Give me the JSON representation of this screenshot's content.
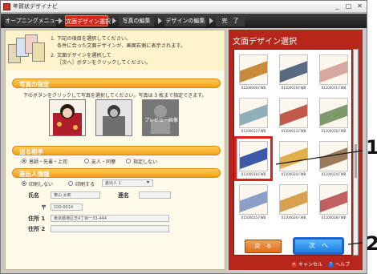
{
  "window": {
    "title": "年賀状デザイナビ"
  },
  "nav": {
    "steps": [
      {
        "label": "オープニングメニュー",
        "active": false
      },
      {
        "label": "文面デザイン選択",
        "active": true
      },
      {
        "label": "写真の編集",
        "active": false
      },
      {
        "label": "デザインの編集",
        "active": false
      },
      {
        "label": "完　了",
        "active": false
      }
    ]
  },
  "instructions": {
    "line1": "1. 下記の項目を選択してください。",
    "line2": "条件に合った文面デザインが、画面右側に表示されます。",
    "line3": "2. 文面デザインを選択して",
    "line4": "［次へ］ボタンをクリックしてください。"
  },
  "photo": {
    "section_title": "写真の指定",
    "hint": "下のボタンをクリックして写真を選択してください。写真は 3 枚まで指定できます。",
    "preview_label": "プレビュー画像"
  },
  "recipient": {
    "section_title": "送る相手",
    "options": [
      {
        "label": "恩師・先輩・上司",
        "checked": true
      },
      {
        "label": "友人・同僚",
        "checked": false
      },
      {
        "label": "指定しない",
        "checked": false
      }
    ]
  },
  "sender": {
    "section_title": "差出人情報",
    "print_options": [
      {
        "label": "印刷しない",
        "checked": true
      },
      {
        "label": "印刷する",
        "checked": false
      }
    ],
    "select_value": "差出人 1",
    "name_label": "氏名",
    "name_value": "筆山 太郎",
    "joint_label": "連名",
    "postal_label": "〒",
    "postal_value": "100-0014",
    "addr1_label": "住所 1",
    "addr1_value": "東京都港区芝4丁目一33-444",
    "addr2_label": "住所 2"
  },
  "panel": {
    "title": "文面デザイン選択",
    "cards": [
      {
        "caption": "01100009.FWB",
        "selected": false,
        "color": "#c98a3c"
      },
      {
        "caption": "01100010.FWB",
        "selected": false,
        "color": "#5a6a82"
      },
      {
        "caption": "01100011.FWB",
        "selected": false,
        "color": "#d7a8a0"
      },
      {
        "caption": "01100012.FWB",
        "selected": false,
        "color": "#8fb0b8"
      },
      {
        "caption": "01100013.FWB",
        "selected": false,
        "color": "#c05a4a"
      },
      {
        "caption": "01100016.FWB",
        "selected": false,
        "color": "#7f9a6a"
      },
      {
        "caption": "01100018.FWB",
        "selected": true,
        "color": "#3d5aa8"
      },
      {
        "caption": "01100020.FWB",
        "selected": false,
        "color": "#e2b04a"
      },
      {
        "caption": "01100024.FWB",
        "selected": false,
        "color": "#9a7a5a"
      },
      {
        "caption": "01100025.FWB",
        "selected": false,
        "color": "#8aa0c8"
      },
      {
        "caption": "01100026.FWB",
        "selected": false,
        "color": "#d8a050"
      },
      {
        "caption": "01100028.FWB",
        "selected": false,
        "color": "#c06060"
      }
    ],
    "back_label": "戻　る",
    "next_label": "次　へ",
    "cancel_label": "キャンセル",
    "help_label": "ヘルプ"
  },
  "callouts": {
    "one": "1",
    "two": "2"
  }
}
